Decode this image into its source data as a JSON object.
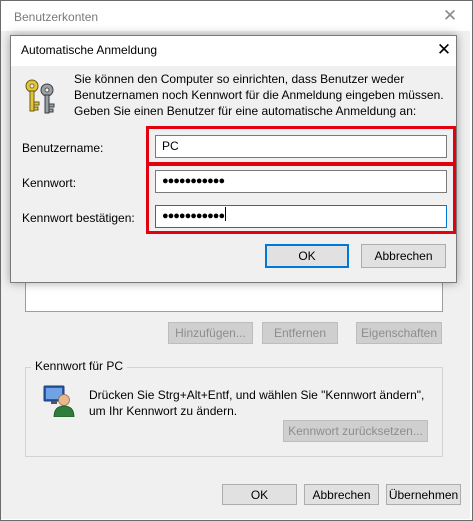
{
  "outer_window": {
    "title": "Benutzerkonten",
    "list_buttons": {
      "add": "Hinzufügen...",
      "remove": "Entfernen",
      "properties": "Eigenschaften"
    },
    "password_group": {
      "title": "Kennwort für PC",
      "text": "Drücken Sie Strg+Alt+Entf, und wählen Sie \"Kennwort ändern\", um Ihr Kennwort zu ändern.",
      "reset_button": "Kennwort zurücksetzen..."
    },
    "footer": {
      "ok": "OK",
      "cancel": "Abbrechen",
      "apply": "Übernehmen"
    }
  },
  "dialog": {
    "title": "Automatische Anmeldung",
    "info": "Sie können den Computer so einrichten, dass Benutzer weder Benutzernamen noch Kennwort für die Anmeldung eingeben müssen. Geben Sie einen Benutzer für eine automatische Anmeldung an:",
    "username_label": "Benutzername:",
    "username_value": "PC",
    "password_label": "Kennwort:",
    "password_value": "●●●●●●●●●●●",
    "confirm_label": "Kennwort bestätigen:",
    "confirm_value": "●●●●●●●●●●●",
    "ok": "OK",
    "cancel": "Abbrechen"
  },
  "colors": {
    "highlight": "#e3000f",
    "focus": "#0078d7"
  },
  "icons": [
    "close-icon",
    "keys-icon",
    "user-icon"
  ]
}
